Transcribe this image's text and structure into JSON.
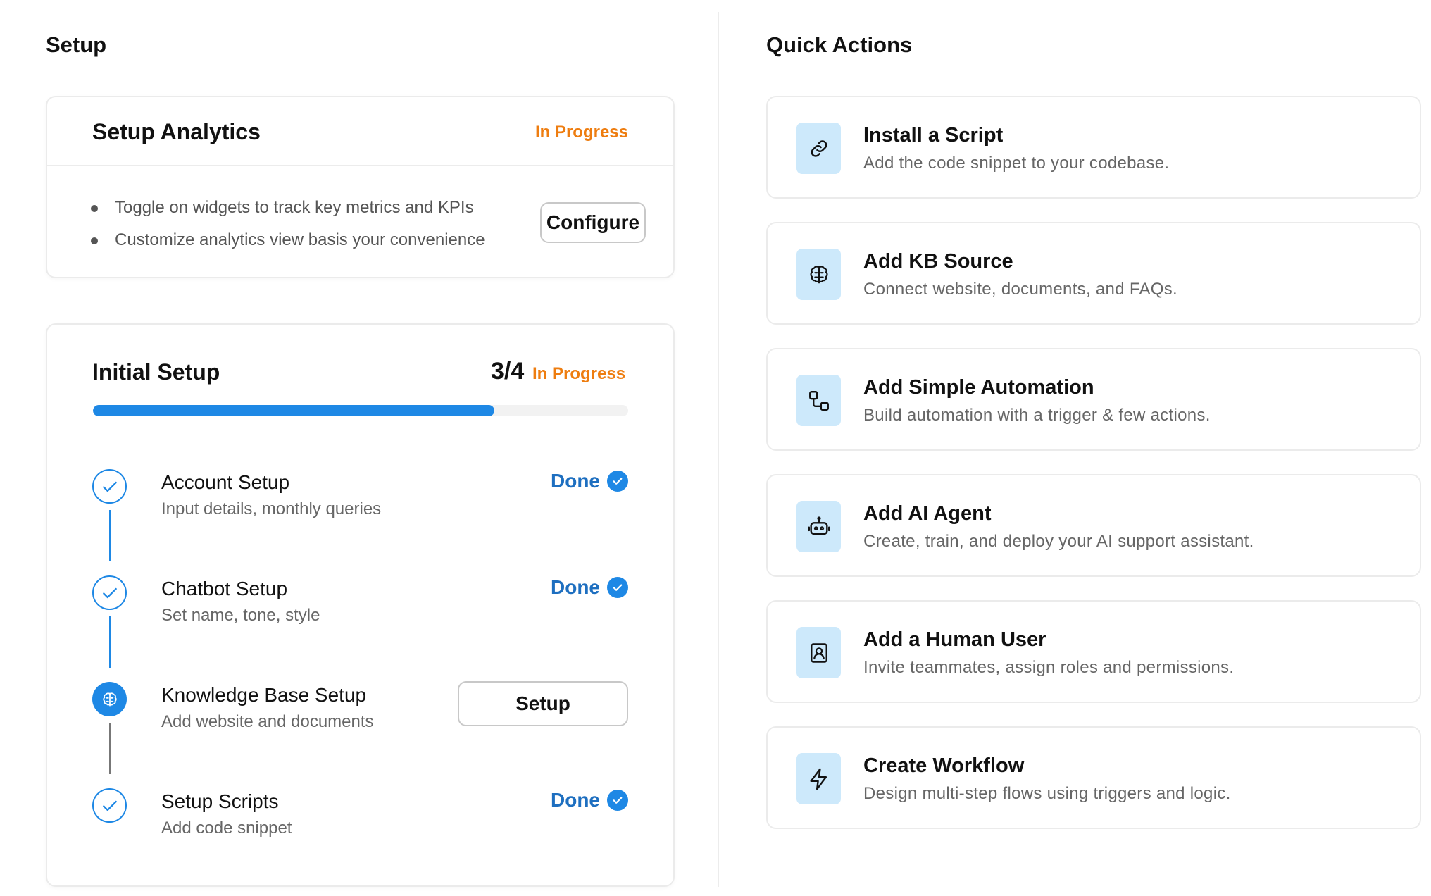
{
  "setup": {
    "title": "Setup",
    "analytics": {
      "title": "Setup Analytics",
      "status": "In Progress",
      "bullets": [
        "Toggle on widgets to track key metrics and KPIs",
        "Customize analytics view basis your convenience"
      ],
      "configure_label": "Configure"
    },
    "initial": {
      "title": "Initial Setup",
      "fraction": "3/4",
      "status": "In Progress",
      "progress": 0.75,
      "steps": [
        {
          "title": "Account Setup",
          "subtitle": "Input details, monthly queries",
          "state": "done",
          "action_label": "Done"
        },
        {
          "title": "Chatbot Setup",
          "subtitle": "Set name, tone, style",
          "state": "done",
          "action_label": "Done"
        },
        {
          "title": "Knowledge Base Setup",
          "subtitle": "Add website and documents",
          "state": "active",
          "action_label": "Setup"
        },
        {
          "title": "Setup Scripts",
          "subtitle": "Add code snippet",
          "state": "done",
          "action_label": "Done"
        }
      ]
    }
  },
  "quick_actions": {
    "title": "Quick Actions",
    "items": [
      {
        "icon": "link-icon",
        "title": "Install a Script",
        "description": "Add the code snippet to your codebase."
      },
      {
        "icon": "brain-icon",
        "title": "Add KB Source",
        "description": "Connect website, documents, and FAQs."
      },
      {
        "icon": "automation-icon",
        "title": "Add Simple Automation",
        "description": "Build automation with a trigger & few actions."
      },
      {
        "icon": "robot-icon",
        "title": "Add AI Agent",
        "description": "Create, train, and deploy your AI support assistant."
      },
      {
        "icon": "user-badge-icon",
        "title": "Add a Human User",
        "description": "Invite teammates, assign roles and permissions."
      },
      {
        "icon": "lightning-icon",
        "title": "Create Workflow",
        "description": "Design multi-step flows using triggers and logic."
      }
    ]
  },
  "colors": {
    "accent_blue": "#1e88e5",
    "done_text_blue": "#1e6fc0",
    "status_orange": "#ee7d10",
    "icon_tile_bg": "#cde9fb"
  }
}
